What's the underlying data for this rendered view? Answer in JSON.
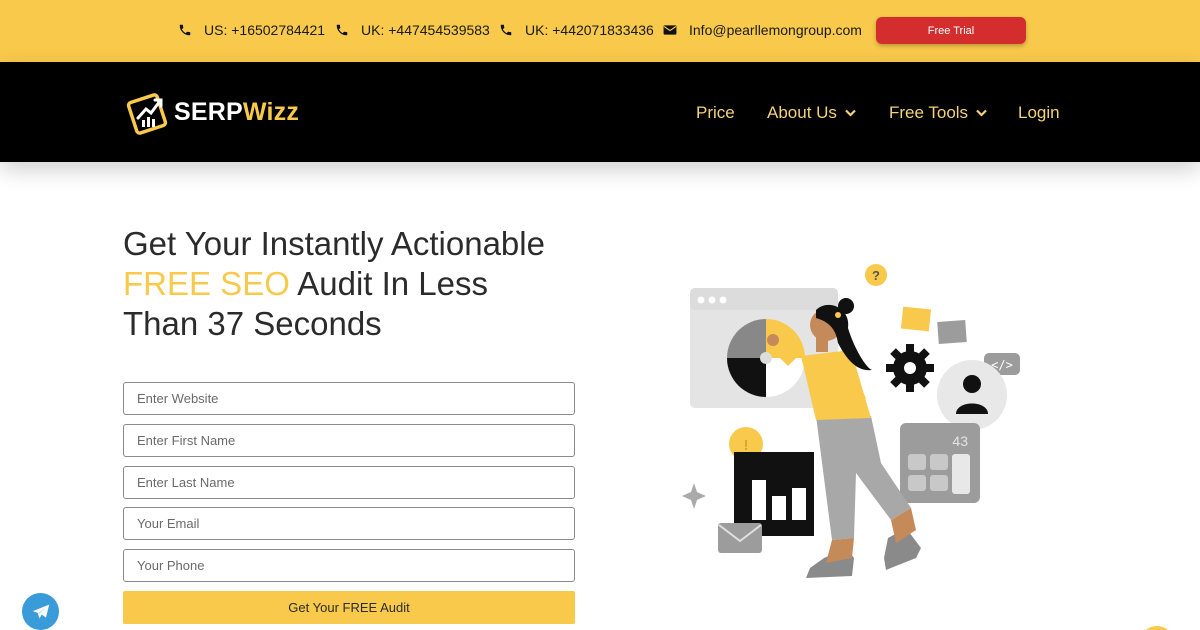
{
  "topbar": {
    "contacts": [
      {
        "icon": "phone-icon",
        "text": "US: +16502784421"
      },
      {
        "icon": "phone-icon",
        "text": "UK: +447454539583"
      },
      {
        "icon": "phone-icon",
        "text": "UK: +442071833436"
      },
      {
        "icon": "envelope-icon",
        "text": "Info@pearllemongroup.com"
      }
    ],
    "trial_label": "Free Trial"
  },
  "header": {
    "logo": {
      "part1": "SERP",
      "part2": "Wizz"
    },
    "nav": [
      {
        "label": "Price",
        "dropdown": false
      },
      {
        "label": "About Us",
        "dropdown": true
      },
      {
        "label": "Free Tools",
        "dropdown": true
      },
      {
        "label": "Login",
        "dropdown": false
      }
    ]
  },
  "hero": {
    "headline_1": "Get Your Instantly Actionable",
    "headline_highlight": "FREE SEO",
    "headline_2": " Audit In Less",
    "headline_3": "Than 37 Seconds"
  },
  "form": {
    "fields": [
      {
        "placeholder": "Enter Website",
        "value": ""
      },
      {
        "placeholder": "Enter First Name",
        "value": ""
      },
      {
        "placeholder": "Enter Last Name",
        "value": ""
      },
      {
        "placeholder": "Your Email",
        "value": ""
      },
      {
        "placeholder": "Your Phone",
        "value": ""
      }
    ],
    "submit_label": "Get Your FREE Audit"
  },
  "illustration": {
    "calculator_display": "43",
    "question_mark": "?",
    "exclamation": "!",
    "code_tag": "</>"
  },
  "colors": {
    "brand_yellow": "#f8c94a",
    "header_black": "#000000",
    "trial_red": "#d42d2d",
    "telegram_blue": "#3a9bd9"
  }
}
